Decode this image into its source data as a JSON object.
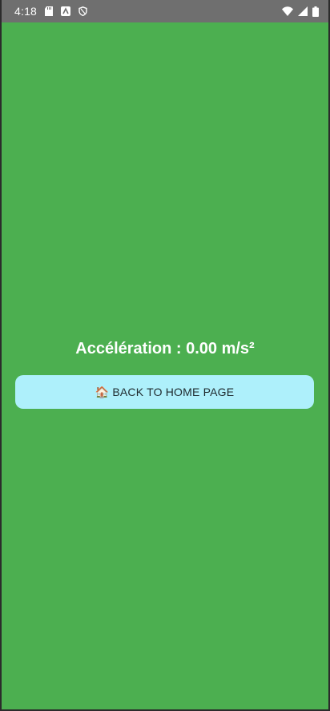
{
  "status_bar": {
    "time": "4:18"
  },
  "main": {
    "acceleration_text": "Accélération : 0.00 m/s²",
    "home_button_icon": "🏠",
    "home_button_label": "BACK TO HOME PAGE"
  },
  "colors": {
    "background": "#4caf50",
    "status_bar": "#6f6f6f",
    "button": "#aef0fb",
    "text_light": "#ffffff",
    "button_text": "#1f2a2e"
  }
}
